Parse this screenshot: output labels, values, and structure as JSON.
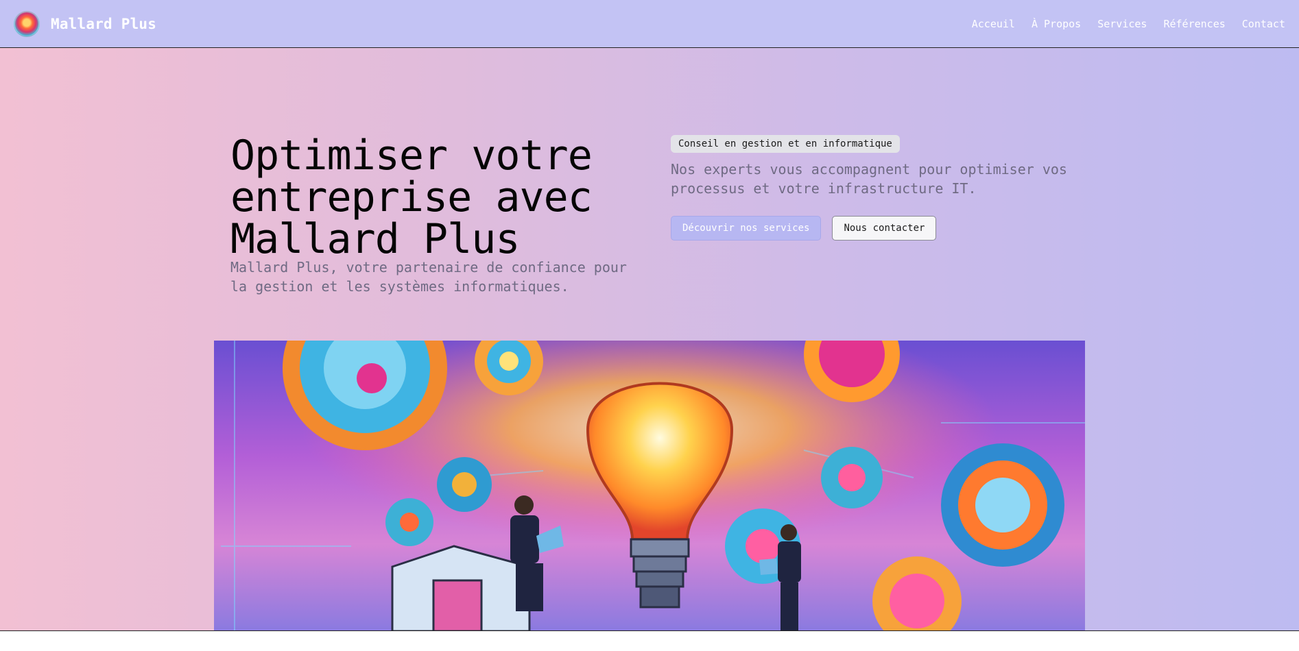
{
  "brand": {
    "name": "Mallard Plus",
    "logo_icon": "mallard-logo-icon"
  },
  "nav": {
    "items": [
      {
        "label": "Acceuil"
      },
      {
        "label": "À Propos"
      },
      {
        "label": "Services"
      },
      {
        "label": "Références"
      },
      {
        "label": "Contact"
      }
    ]
  },
  "hero": {
    "title": "Optimiser votre entreprise avec Mallard Plus",
    "subtitle": "Mallard Plus, votre partenaire de confiance pour la gestion et les systèmes informatiques.",
    "badge": "Conseil en gestion et en informatique",
    "description": "Nos experts vous accompagnent pour optimiser vos processus et votre infrastructure IT.",
    "primary_button": "Découvrir nos services",
    "secondary_button": "Nous contacter",
    "image_icon": "lightbulb-gears-illustration"
  },
  "colors": {
    "navbar": "#c3c3f4",
    "primary_button": "#b7b7f2",
    "muted_text": "#6f6a83"
  }
}
